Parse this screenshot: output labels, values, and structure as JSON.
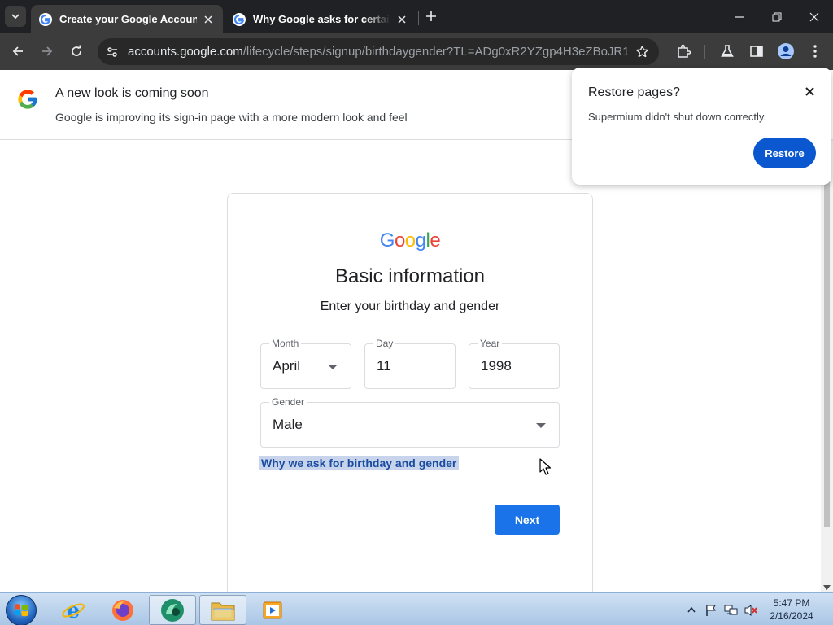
{
  "browser": {
    "tabs": [
      {
        "title": "Create your Google Account",
        "active": true
      },
      {
        "title": "Why Google asks for certain info",
        "active": false
      }
    ],
    "url_host": "accounts.google.com",
    "url_path": "/lifecycle/steps/signup/birthdaygender?TL=ADg0xR2YZgp4H3eZBoJR1iw3xt..."
  },
  "banner": {
    "title": "A new look is coming soon",
    "description": "Google is improving its sign-in page with a more modern look and feel"
  },
  "card": {
    "logo_text": "Google",
    "title": "Basic information",
    "subtitle": "Enter your birthday and gender",
    "fields": {
      "month": {
        "label": "Month",
        "value": "April"
      },
      "day": {
        "label": "Day",
        "value": "11"
      },
      "year": {
        "label": "Year",
        "value": "1998"
      },
      "gender": {
        "label": "Gender",
        "value": "Male"
      }
    },
    "why_link": "Why we ask for birthday and gender",
    "next_label": "Next"
  },
  "popup": {
    "title": "Restore pages?",
    "description": "Supermium didn't shut down correctly.",
    "button": "Restore"
  },
  "taskbar": {
    "time": "5:47 PM",
    "date": "2/16/2024",
    "pinned": [
      "internet-explorer",
      "firefox",
      "browser-green",
      "file-explorer",
      "media-player"
    ]
  },
  "colors": {
    "primary_button": "#1a73e8",
    "restore_button": "#0b57d0",
    "link_highlight": "#c7d4ec"
  }
}
